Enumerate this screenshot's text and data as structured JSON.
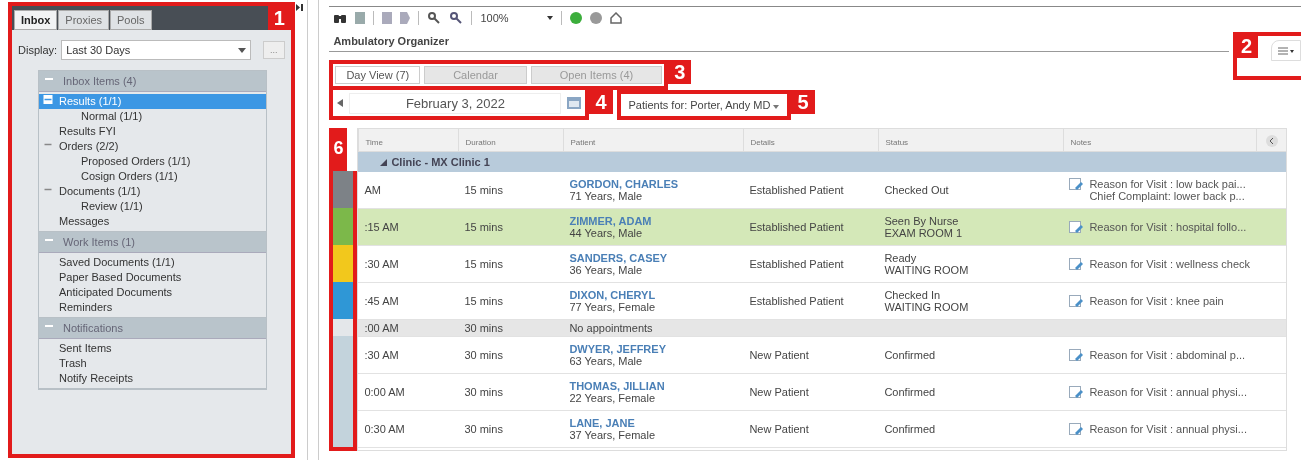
{
  "left_panel": {
    "callout": "1",
    "tabs": [
      {
        "label": "Inbox",
        "selected": true
      },
      {
        "label": "Proxies",
        "selected": false
      },
      {
        "label": "Pools",
        "selected": false
      }
    ],
    "display": {
      "label": "Display:",
      "value": "Last 30 Days",
      "more": "..."
    },
    "sections": [
      {
        "title": "Inbox Items (4)",
        "expanded": true,
        "items": [
          {
            "label": "Results (1/1)",
            "selected": true,
            "expanded": true,
            "children": [
              {
                "label": "Normal (1/1)",
                "selected": false
              }
            ]
          },
          {
            "label": "Results FYI",
            "selected": false
          },
          {
            "label": "Orders (2/2)",
            "selected": false,
            "expanded": true,
            "children": [
              {
                "label": "Proposed Orders (1/1)",
                "selected": false
              },
              {
                "label": "Cosign Orders (1/1)",
                "selected": false
              }
            ]
          },
          {
            "label": "Documents (1/1)",
            "selected": false,
            "expanded": true,
            "children": [
              {
                "label": "Review (1/1)",
                "selected": false
              }
            ]
          },
          {
            "label": "Messages",
            "selected": false
          }
        ]
      },
      {
        "title": "Work Items (1)",
        "expanded": true,
        "items": [
          {
            "label": "Saved Documents (1/1)",
            "selected": false
          },
          {
            "label": "Paper Based Documents",
            "selected": false
          },
          {
            "label": "Anticipated Documents",
            "selected": false
          },
          {
            "label": "Reminders",
            "selected": false
          }
        ]
      },
      {
        "title": "Notifications",
        "expanded": true,
        "items": [
          {
            "label": "Sent Items",
            "selected": false
          },
          {
            "label": "Trash",
            "selected": false
          },
          {
            "label": "Notify Receipts",
            "selected": false
          }
        ]
      }
    ]
  },
  "toolbar": {
    "zoom": "100%"
  },
  "title": "Ambulatory Organizer",
  "menu_callout": "2",
  "tabs_callout": "3",
  "tabs": [
    {
      "label": "Day View  (7)",
      "selected": true
    },
    {
      "label": "Calendar",
      "selected": false
    },
    {
      "label": "Open Items  (4)",
      "selected": false
    }
  ],
  "date_callout": "4",
  "date": "February 3, 2022",
  "patients_callout": "5",
  "patients_for": "Patients for:  Porter, Andy MD",
  "strip_callout": "6",
  "table": {
    "columns": [
      "Time",
      "Duration",
      "Patient",
      "Details",
      "Status",
      "Notes"
    ],
    "group": {
      "label": "Clinic - MX Clinic 1",
      "expanded": true
    },
    "rows": [
      {
        "kind": "appointment",
        "color": "#7d8287",
        "highlighted": false,
        "time": "AM",
        "duration": "15 mins",
        "name": "GORDON, CHARLES",
        "info": "71 Years, Male",
        "details": "Established Patient",
        "status": [
          "Checked Out"
        ],
        "notes": [
          "Reason for Visit : low back pai...",
          "Chief Complaint: lower back p..."
        ]
      },
      {
        "kind": "appointment",
        "color": "#7cb84a",
        "highlighted": true,
        "time": ":15 AM",
        "duration": "15 mins",
        "name": "ZIMMER, ADAM",
        "info": "44 Years, Male",
        "details": "Established Patient",
        "status": [
          "Seen By Nurse",
          "EXAM ROOM 1"
        ],
        "notes": [
          "Reason for Visit : hospital follo..."
        ]
      },
      {
        "kind": "appointment",
        "color": "#f2c81c",
        "highlighted": false,
        "time": ":30 AM",
        "duration": "15 mins",
        "name": "SANDERS, CASEY",
        "info": "36 Years, Male",
        "details": "Established Patient",
        "status": [
          "Ready",
          "WAITING ROOM"
        ],
        "notes": [
          "Reason for Visit : wellness check"
        ]
      },
      {
        "kind": "appointment",
        "color": "#2f97d6",
        "highlighted": false,
        "time": ":45 AM",
        "duration": "15 mins",
        "name": "DIXON, CHERYL",
        "info": "77 Years, Female",
        "details": "Established Patient",
        "status": [
          "Checked In",
          "WAITING ROOM"
        ],
        "notes": [
          "Reason for Visit : knee pain"
        ]
      },
      {
        "kind": "empty",
        "color": "#e4e7ea",
        "time": ":00 AM",
        "duration": "30 mins",
        "label": "No appointments"
      },
      {
        "kind": "appointment",
        "color": "#c3d3dc",
        "highlighted": false,
        "time": ":30 AM",
        "duration": "30 mins",
        "name": "DWYER, JEFFREY",
        "info": "63 Years, Male",
        "details": "New Patient",
        "status": [
          "Confirmed"
        ],
        "notes": [
          "Reason for Visit : abdominal p..."
        ]
      },
      {
        "kind": "appointment",
        "color": "#c3d3dc",
        "highlighted": false,
        "time": "0:00 AM",
        "duration": "30 mins",
        "name": "THOMAS, JILLIAN",
        "info": "22 Years, Female",
        "details": "New Patient",
        "status": [
          "Confirmed"
        ],
        "notes": [
          "Reason for Visit : annual physi..."
        ]
      },
      {
        "kind": "appointment",
        "color": "#c3d3dc",
        "highlighted": false,
        "time": "0:30 AM",
        "duration": "30 mins",
        "name": "LANE, JANE",
        "info": "37 Years, Female",
        "details": "New Patient",
        "status": [
          "Confirmed"
        ],
        "notes": [
          "Reason for Visit : annual physi..."
        ]
      }
    ]
  }
}
